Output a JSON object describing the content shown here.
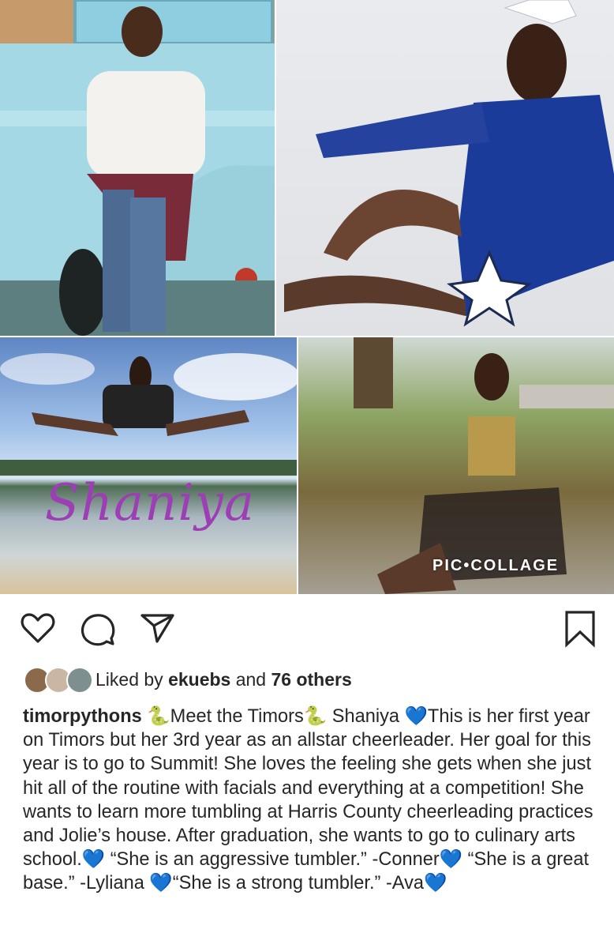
{
  "post": {
    "collage": {
      "name_overlay": "Shaniya",
      "watermark": "PIC•COLLAGE"
    },
    "actions": {
      "like_icon": "heart-icon",
      "comment_icon": "comment-icon",
      "share_icon": "send-icon",
      "save_icon": "bookmark-icon"
    },
    "likes": {
      "prefix": "Liked by ",
      "user": "ekuebs",
      "middle": " and ",
      "others": "76 others"
    },
    "caption": {
      "username": "timorpythons",
      "text": " 🐍Meet the Timors🐍 Shaniya 💙This is her first year on Timors but her 3rd year as an allstar cheerleader. Her goal for this year is to go to Summit! She loves the feeling she gets when she just hit all of the routine with facials and everything at a competition! She wants to learn more tumbling at Harris County cheerleading practices and Jolie’s house.  After graduation, she wants to go to culinary arts school.💙 “She is an aggressive tumbler.” -Conner💙 “She is a great base.” -Lyliana 💙“She is a strong tumbler.” -Ava💙"
    }
  },
  "colors": {
    "text": "#262626",
    "background": "#ffffff",
    "name_overlay": "#9c3fb5"
  }
}
